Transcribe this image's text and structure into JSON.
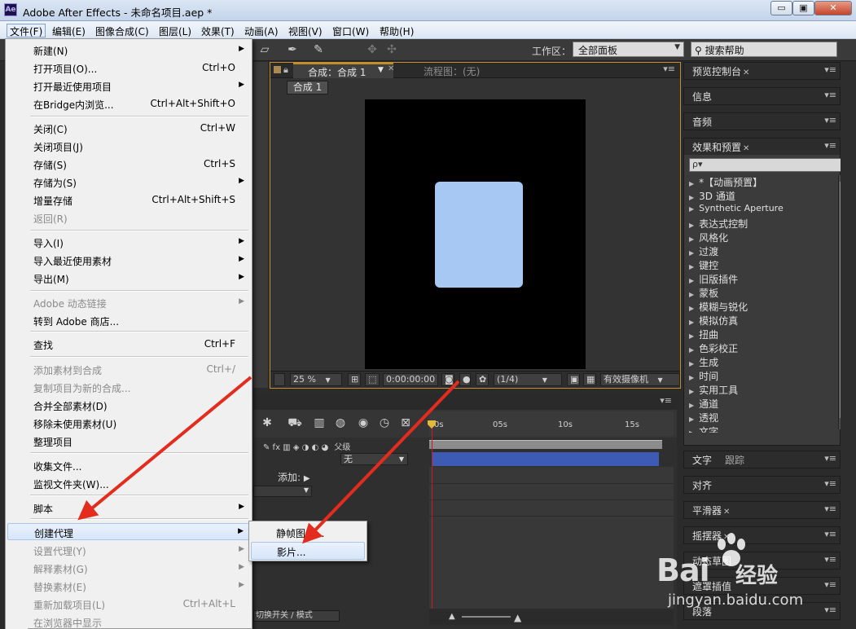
{
  "window": {
    "title": "Adobe After Effects - 未命名项目.aep *",
    "logo": "Ae",
    "min": "▭",
    "max": "▣",
    "close": "✕"
  },
  "menubar": [
    "文件(F)",
    "编辑(E)",
    "图像合成(C)",
    "图层(L)",
    "效果(T)",
    "动画(A)",
    "视图(V)",
    "窗口(W)",
    "帮助(H)"
  ],
  "toolbar": {
    "workspace_label": "工作区：",
    "workspace_value": "全部面板",
    "search_help": "搜索帮助"
  },
  "file_menu": [
    {
      "label": "新建(N)",
      "shortcut": "",
      "sub": true,
      "disabled": false
    },
    {
      "label": "打开项目(O)...",
      "shortcut": "Ctrl+O",
      "sub": false,
      "disabled": false
    },
    {
      "label": "打开最近使用项目",
      "shortcut": "",
      "sub": true,
      "disabled": false
    },
    {
      "label": "在Bridge内浏览...",
      "shortcut": "Ctrl+Alt+Shift+O",
      "sub": false,
      "disabled": false
    },
    {
      "label": "关闭(C)",
      "shortcut": "Ctrl+W",
      "sub": false,
      "disabled": false
    },
    {
      "label": "关闭项目(J)",
      "shortcut": "",
      "sub": false,
      "disabled": false
    },
    {
      "label": "存储(S)",
      "shortcut": "Ctrl+S",
      "sub": false,
      "disabled": false
    },
    {
      "label": "存储为(S)",
      "shortcut": "",
      "sub": true,
      "disabled": false
    },
    {
      "label": "增量存储",
      "shortcut": "Ctrl+Alt+Shift+S",
      "sub": false,
      "disabled": false
    },
    {
      "label": "返回(R)",
      "shortcut": "",
      "sub": false,
      "disabled": true
    },
    {
      "label": "导入(I)",
      "shortcut": "",
      "sub": true,
      "disabled": false
    },
    {
      "label": "导入最近使用素材",
      "shortcut": "",
      "sub": true,
      "disabled": false
    },
    {
      "label": "导出(M)",
      "shortcut": "",
      "sub": true,
      "disabled": false
    },
    {
      "label": "Adobe 动态链接",
      "shortcut": "",
      "sub": true,
      "disabled": true
    },
    {
      "label": "转到 Adobe 商店...",
      "shortcut": "",
      "sub": false,
      "disabled": false
    },
    {
      "label": "查找",
      "shortcut": "Ctrl+F",
      "sub": false,
      "disabled": false
    },
    {
      "label": "添加素材到合成",
      "shortcut": "Ctrl+/",
      "sub": false,
      "disabled": true
    },
    {
      "label": "复制项目为新的合成...",
      "shortcut": "",
      "sub": false,
      "disabled": true
    },
    {
      "label": "合并全部素材(D)",
      "shortcut": "",
      "sub": false,
      "disabled": false
    },
    {
      "label": "移除未使用素材(U)",
      "shortcut": "",
      "sub": false,
      "disabled": false
    },
    {
      "label": "整理项目",
      "shortcut": "",
      "sub": false,
      "disabled": false
    },
    {
      "label": "收集文件...",
      "shortcut": "",
      "sub": false,
      "disabled": false
    },
    {
      "label": "监视文件夹(W)...",
      "shortcut": "",
      "sub": false,
      "disabled": false
    },
    {
      "label": "脚本",
      "shortcut": "",
      "sub": true,
      "disabled": false
    },
    {
      "label": "创建代理",
      "shortcut": "",
      "sub": true,
      "disabled": false,
      "highlighted": true
    },
    {
      "label": "设置代理(Y)",
      "shortcut": "",
      "sub": true,
      "disabled": true
    },
    {
      "label": "解释素材(G)",
      "shortcut": "",
      "sub": true,
      "disabled": true
    },
    {
      "label": "替换素材(E)",
      "shortcut": "",
      "sub": true,
      "disabled": true
    },
    {
      "label": "重新加载项目(L)",
      "shortcut": "Ctrl+Alt+L",
      "sub": false,
      "disabled": true
    },
    {
      "label": "在浏览器中显示",
      "shortcut": "",
      "sub": false,
      "disabled": true
    }
  ],
  "proxy_submenu": [
    "静帧图像...",
    "影片..."
  ],
  "comp": {
    "tab": "合成：合成 1",
    "flow_tab": "流程图：(无)",
    "subtab": "合成 1",
    "zoom": "25 %",
    "timecode": "0:00:00:00",
    "resolution": "(1/4)",
    "camera": "有效摄像机",
    "card_color": "#a6c8f2",
    "border_color": "#c28f2c"
  },
  "right_panels": {
    "preview": "预览控制台",
    "info": "信息",
    "audio": "音频",
    "effects": "效果和预置",
    "effects_search": "ρ▾",
    "effects_list": [
      "*【动画预置】",
      "3D 通道",
      "Synthetic Aperture",
      "表达式控制",
      "风格化",
      "过渡",
      "键控",
      "旧版插件",
      "蒙板",
      "模糊与锐化",
      "模拟仿真",
      "扭曲",
      "色彩校正",
      "生成",
      "时间",
      "实用工具",
      "通道",
      "透视",
      "文字"
    ],
    "text": "文字",
    "tracker": "跟踪",
    "align": "对齐",
    "smoother": "平滑器",
    "wiggler": "摇摆器",
    "motion": "动态草图",
    "mask_interp": "遮罩插值",
    "paragraph": "段落"
  },
  "timeline": {
    "ticks": [
      "0s",
      "05s",
      "10s",
      "15s"
    ],
    "parent_label": "父级",
    "none": "无",
    "add": "添加:",
    "switch_mode": "切换开关 / 模式"
  },
  "watermark": {
    "logo": "Bai",
    "logo2": "经验",
    "url": "jingyan.baidu.com"
  }
}
